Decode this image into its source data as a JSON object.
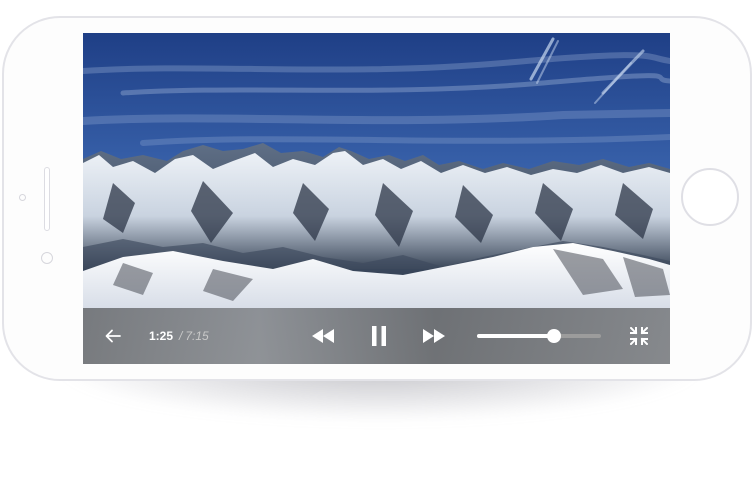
{
  "player": {
    "current_time": "1:25",
    "separator": "/",
    "duration": "7:15",
    "volume_level": 0.62
  },
  "icons": {
    "back": "arrow-left-icon",
    "rewind": "rewind-icon",
    "pause": "pause-icon",
    "forward": "fast-forward-icon",
    "fullscreen": "fullscreen-exit-icon"
  },
  "colors": {
    "control_bar": "#8a8a8a",
    "control_icon": "#ffffff",
    "duration_text": "#c9c9c9",
    "volume_track": "#9c9c9c"
  }
}
